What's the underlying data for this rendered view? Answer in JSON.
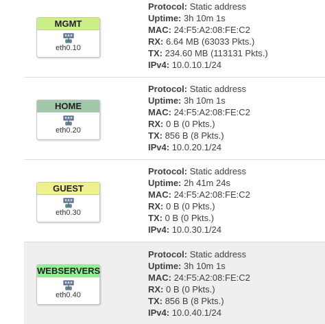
{
  "interfaces": [
    {
      "name": "MGMT",
      "color": "#ccee88",
      "device": "eth0.10",
      "protocol_label": "Protocol:",
      "protocol": "Static address",
      "uptime_label": "Uptime:",
      "uptime": "3h 10m 1s",
      "mac_label": "MAC:",
      "mac": "24:F5:A2:08:FE:C2",
      "rx_label": "RX:",
      "rx": "6.64 MB (63033 Pkts.)",
      "tx_label": "TX:",
      "tx": "234.60 MB (113131 Pkts.)",
      "ipv4_label": "IPv4:",
      "ipv4": "10.0.10.1/24"
    },
    {
      "name": "HOME",
      "color": "#a2c7ab",
      "device": "eth0.20",
      "protocol_label": "Protocol:",
      "protocol": "Static address",
      "uptime_label": "Uptime:",
      "uptime": "3h 10m 1s",
      "mac_label": "MAC:",
      "mac": "24:F5:A2:08:FE:C2",
      "rx_label": "RX:",
      "rx": "0 B (0 Pkts.)",
      "tx_label": "TX:",
      "tx": "856 B (8 Pkts.)",
      "ipv4_label": "IPv4:",
      "ipv4": "10.0.20.1/24"
    },
    {
      "name": "GUEST",
      "color": "#f0f08f",
      "device": "eth0.30",
      "protocol_label": "Protocol:",
      "protocol": "Static address",
      "uptime_label": "Uptime:",
      "uptime": "2h 41m 24s",
      "mac_label": "MAC:",
      "mac": "24:F5:A2:08:FE:C2",
      "rx_label": "RX:",
      "rx": "0 B (0 Pkts.)",
      "tx_label": "TX:",
      "tx": "0 B (0 Pkts.)",
      "ipv4_label": "IPv4:",
      "ipv4": "10.0.30.1/24"
    },
    {
      "name": "WEBSERVERS",
      "color": "#90f090",
      "device": "eth0.40",
      "protocol_label": "Protocol:",
      "protocol": "Static address",
      "uptime_label": "Uptime:",
      "uptime": "3h 10m 1s",
      "mac_label": "MAC:",
      "mac": "24:F5:A2:08:FE:C2",
      "rx_label": "RX:",
      "rx": "0 B (0 Pkts.)",
      "tx_label": "TX:",
      "tx": "856 B (8 Pkts.)",
      "ipv4_label": "IPv4:",
      "ipv4": "10.0.40.1/24"
    }
  ],
  "icon": "network-port-icon"
}
